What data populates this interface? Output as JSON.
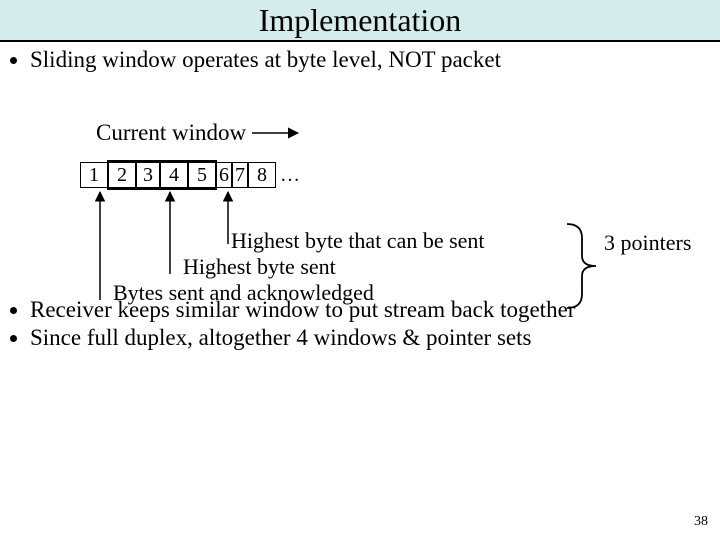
{
  "slide": {
    "title": "Implementation",
    "bullet1": "Sliding window operates at byte level, NOT packet",
    "bullet2": "Receiver keeps similar window to put stream back together",
    "bullet3": "Since full duplex, altogether 4 windows & pointer sets",
    "page_number": "38"
  },
  "diagram": {
    "current_window_label": "Current window",
    "cells": {
      "c1": "1",
      "c2": "2",
      "c3": "3",
      "c4": "4",
      "c5": "5",
      "c6": "6",
      "c7": "7",
      "c8": "8",
      "ellipsis": "…"
    },
    "pointer_labels": {
      "highest_can_send": "Highest byte that can be sent",
      "highest_sent": "Highest byte sent",
      "acked": "Bytes sent and acknowledged"
    },
    "three_pointers": "3 pointers"
  }
}
